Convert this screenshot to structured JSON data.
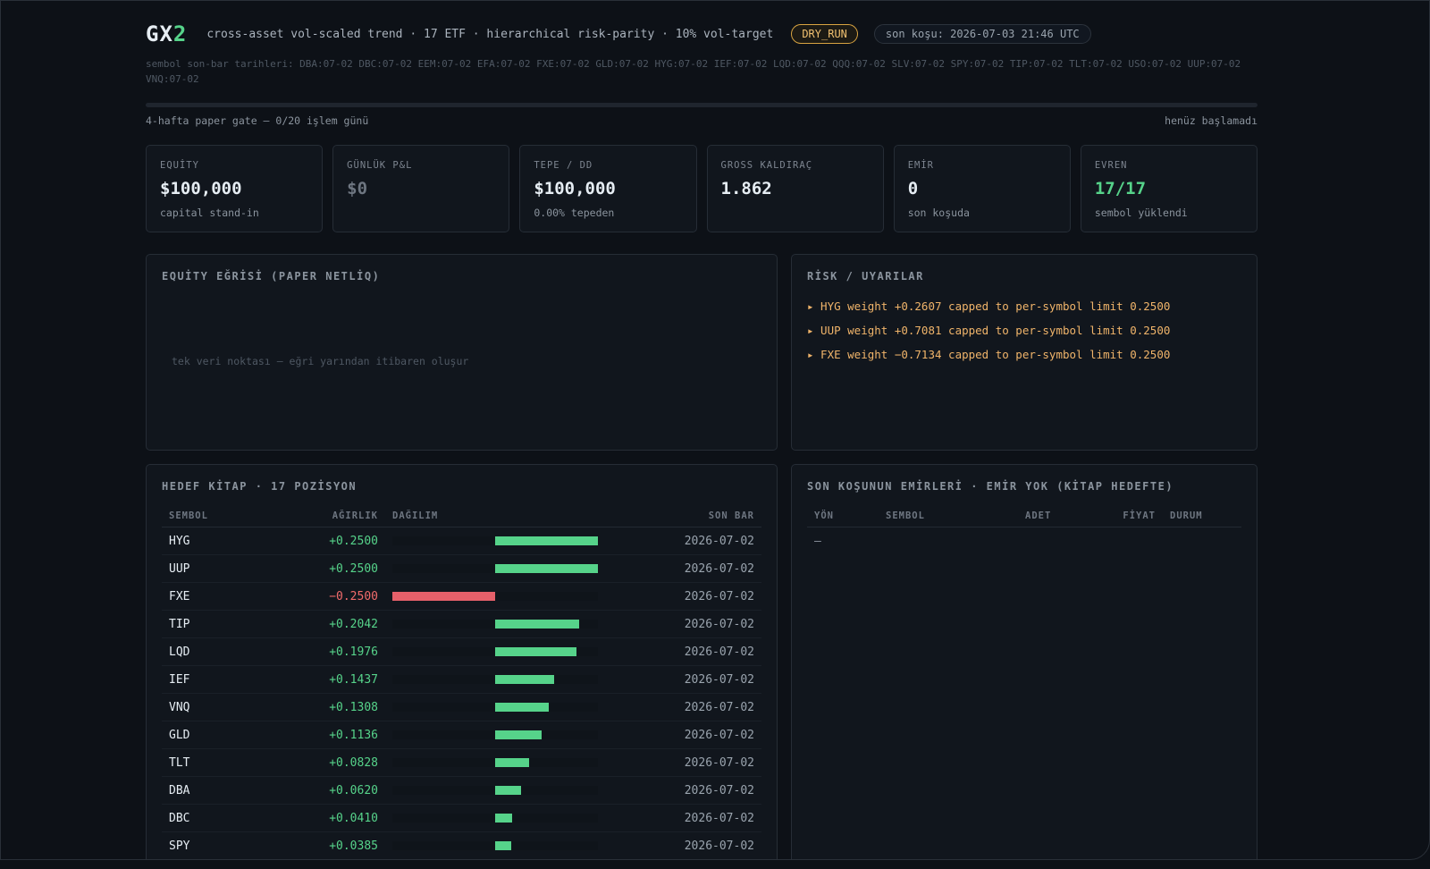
{
  "header": {
    "logo_main": "GX",
    "logo_accent": "2",
    "subtitle": "cross-asset vol-scaled trend · 17 ETF · hierarchical risk-parity · 10% vol-target",
    "mode_badge": "DRY_RUN",
    "last_run": "son koşu: 2026-07-03 21:46 UTC",
    "bar_dates": "sembol son-bar tarihleri: DBA:07-02 DBC:07-02 EEM:07-02 EFA:07-02 FXE:07-02 GLD:07-02 HYG:07-02 IEF:07-02 LQD:07-02 QQQ:07-02 SLV:07-02 SPY:07-02 TIP:07-02 TLT:07-02 USO:07-02 UUP:07-02 VNQ:07-02"
  },
  "gate": {
    "label": "4-hafta paper gate — 0/20 işlem günü",
    "status": "henüz başlamadı",
    "progress": 0
  },
  "cards": [
    {
      "label": "EQUİTY",
      "value": "$100,000",
      "sub": "capital stand-in",
      "tone": "normal"
    },
    {
      "label": "GÜNLÜK P&L",
      "value": "$0",
      "sub": "",
      "tone": "muted"
    },
    {
      "label": "TEPE / DD",
      "value": "$100,000",
      "sub": "0.00% tepeden",
      "tone": "normal"
    },
    {
      "label": "GROSS KALDIRAÇ",
      "value": "1.862",
      "sub": "",
      "tone": "normal"
    },
    {
      "label": "EMİR",
      "value": "0",
      "sub": "son koşuda",
      "tone": "normal"
    },
    {
      "label": "EVREN",
      "value": "17/17",
      "sub": "sembol yüklendi",
      "tone": "green"
    }
  ],
  "equity": {
    "title": "EQUİTY EĞRİSİ (PAPER NETLİQ)",
    "empty_text": "tek veri noktası — eğri yarından itibaren oluşur"
  },
  "risk": {
    "title": "RİSK / UYARILAR",
    "warnings": [
      "▸ HYG weight +0.2607 capped to per-symbol limit 0.2500",
      "▸ UUP weight +0.7081 capped to per-symbol limit 0.2500",
      "▸ FXE weight −0.7134 capped to per-symbol limit 0.2500"
    ]
  },
  "book": {
    "title": "HEDEF KİTAP · 17 POZİSYON",
    "columns": {
      "symbol": "SEMBOL",
      "weight": "AĞIRLIK",
      "dist": "DAĞILIM",
      "bar": "SON BAR"
    },
    "rows": [
      {
        "symbol": "HYG",
        "weight_label": "+0.2500",
        "weight": 0.25,
        "bar": "2026-07-02"
      },
      {
        "symbol": "UUP",
        "weight_label": "+0.2500",
        "weight": 0.25,
        "bar": "2026-07-02"
      },
      {
        "symbol": "FXE",
        "weight_label": "−0.2500",
        "weight": -0.25,
        "bar": "2026-07-02"
      },
      {
        "symbol": "TIP",
        "weight_label": "+0.2042",
        "weight": 0.2042,
        "bar": "2026-07-02"
      },
      {
        "symbol": "LQD",
        "weight_label": "+0.1976",
        "weight": 0.1976,
        "bar": "2026-07-02"
      },
      {
        "symbol": "IEF",
        "weight_label": "+0.1437",
        "weight": 0.1437,
        "bar": "2026-07-02"
      },
      {
        "symbol": "VNQ",
        "weight_label": "+0.1308",
        "weight": 0.1308,
        "bar": "2026-07-02"
      },
      {
        "symbol": "GLD",
        "weight_label": "+0.1136",
        "weight": 0.1136,
        "bar": "2026-07-02"
      },
      {
        "symbol": "TLT",
        "weight_label": "+0.0828",
        "weight": 0.0828,
        "bar": "2026-07-02"
      },
      {
        "symbol": "DBA",
        "weight_label": "+0.0620",
        "weight": 0.062,
        "bar": "2026-07-02"
      },
      {
        "symbol": "DBC",
        "weight_label": "+0.0410",
        "weight": 0.041,
        "bar": "2026-07-02"
      },
      {
        "symbol": "SPY",
        "weight_label": "+0.0385",
        "weight": 0.0385,
        "bar": "2026-07-02"
      }
    ],
    "max_weight": 0.25
  },
  "orders": {
    "title": "SON KOŞUNUN EMİRLERİ · EMİR YOK (KİTAP HEDEFTE)",
    "columns": {
      "side": "YÖN",
      "symbol": "SEMBOL",
      "qty": "ADET",
      "price": "FİYAT",
      "status": "DURUM"
    },
    "empty": "—"
  },
  "colors": {
    "positive": "#56d38a",
    "negative": "#e5606a"
  }
}
